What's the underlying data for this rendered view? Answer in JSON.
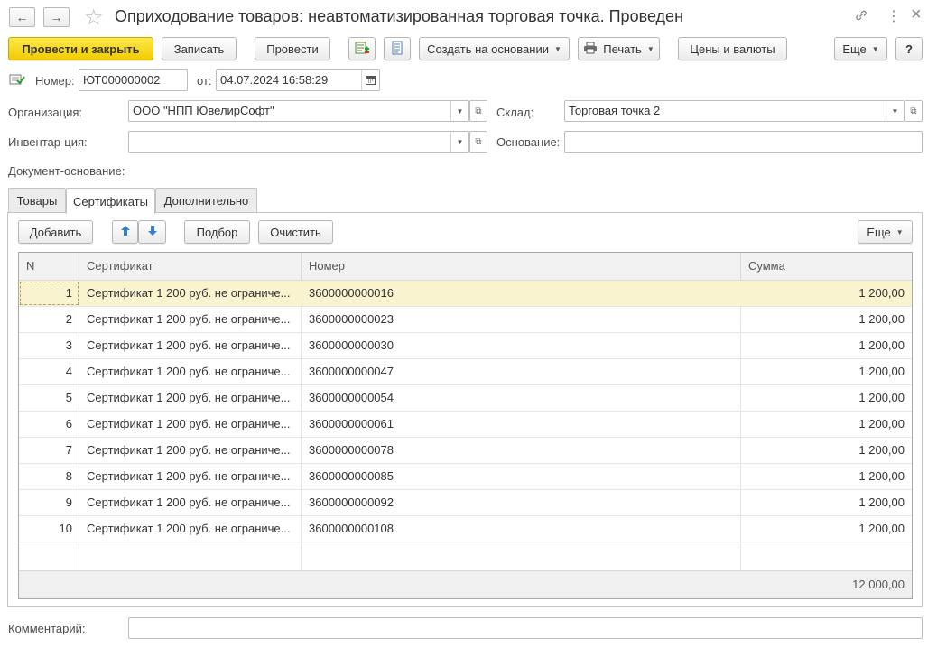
{
  "window": {
    "title": "Оприходование товаров: неавтоматизированная торговая точка. Проведен",
    "back_icon": "←",
    "forward_icon": "→",
    "star_icon": "☆",
    "link_icon": "🔗",
    "more_icon": "⋮",
    "close_icon": "×"
  },
  "toolbar": {
    "post_close": "Провести и закрыть",
    "save": "Записать",
    "post": "Провести",
    "create_based": "Создать на основании",
    "print": "Печать",
    "prices": "Цены и валюты",
    "more": "Еще",
    "help": "?"
  },
  "header": {
    "number_label": "Номер:",
    "number_value": "ЮТ000000002",
    "date_label": "от:",
    "date_value": "04.07.2024 16:58:29"
  },
  "form": {
    "org_label": "Организация:",
    "org_value": "ООО \"НПП ЮвелирСофт\"",
    "warehouse_label": "Склад:",
    "warehouse_value": "Торговая точка 2",
    "inventory_label": "Инвентар-ция:",
    "inventory_value": "",
    "basis_label": "Основание:",
    "basis_value": "",
    "base_doc_label": "Документ-основание:",
    "comment_label": "Комментарий:",
    "comment_value": ""
  },
  "tabs": [
    "Товары",
    "Сертификаты",
    "Дополнительно"
  ],
  "table_toolbar": {
    "add": "Добавить",
    "select": "Подбор",
    "clear": "Очистить",
    "more": "Еще"
  },
  "table": {
    "columns": [
      "N",
      "Сертификат",
      "Номер",
      "Сумма"
    ],
    "rows": [
      {
        "n": "1",
        "cert": "Сертификат 1 200 руб. не ограниче...",
        "num": "3600000000016",
        "sum": "1 200,00"
      },
      {
        "n": "2",
        "cert": "Сертификат 1 200 руб. не ограниче...",
        "num": "3600000000023",
        "sum": "1 200,00"
      },
      {
        "n": "3",
        "cert": "Сертификат 1 200 руб. не ограниче...",
        "num": "3600000000030",
        "sum": "1 200,00"
      },
      {
        "n": "4",
        "cert": "Сертификат 1 200 руб. не ограниче...",
        "num": "3600000000047",
        "sum": "1 200,00"
      },
      {
        "n": "5",
        "cert": "Сертификат 1 200 руб. не ограниче...",
        "num": "3600000000054",
        "sum": "1 200,00"
      },
      {
        "n": "6",
        "cert": "Сертификат 1 200 руб. не ограниче...",
        "num": "3600000000061",
        "sum": "1 200,00"
      },
      {
        "n": "7",
        "cert": "Сертификат 1 200 руб. не ограниче...",
        "num": "3600000000078",
        "sum": "1 200,00"
      },
      {
        "n": "8",
        "cert": "Сертификат 1 200 руб. не ограниче...",
        "num": "3600000000085",
        "sum": "1 200,00"
      },
      {
        "n": "9",
        "cert": "Сертификат 1 200 руб. не ограниче...",
        "num": "3600000000092",
        "sum": "1 200,00"
      },
      {
        "n": "10",
        "cert": "Сертификат 1 200 руб. не ограниче...",
        "num": "3600000000108",
        "sum": "1 200,00"
      }
    ],
    "total": "12 000,00"
  },
  "colors": {
    "primary_button": "#f2cc00",
    "selected_row": "#faf3d0"
  }
}
